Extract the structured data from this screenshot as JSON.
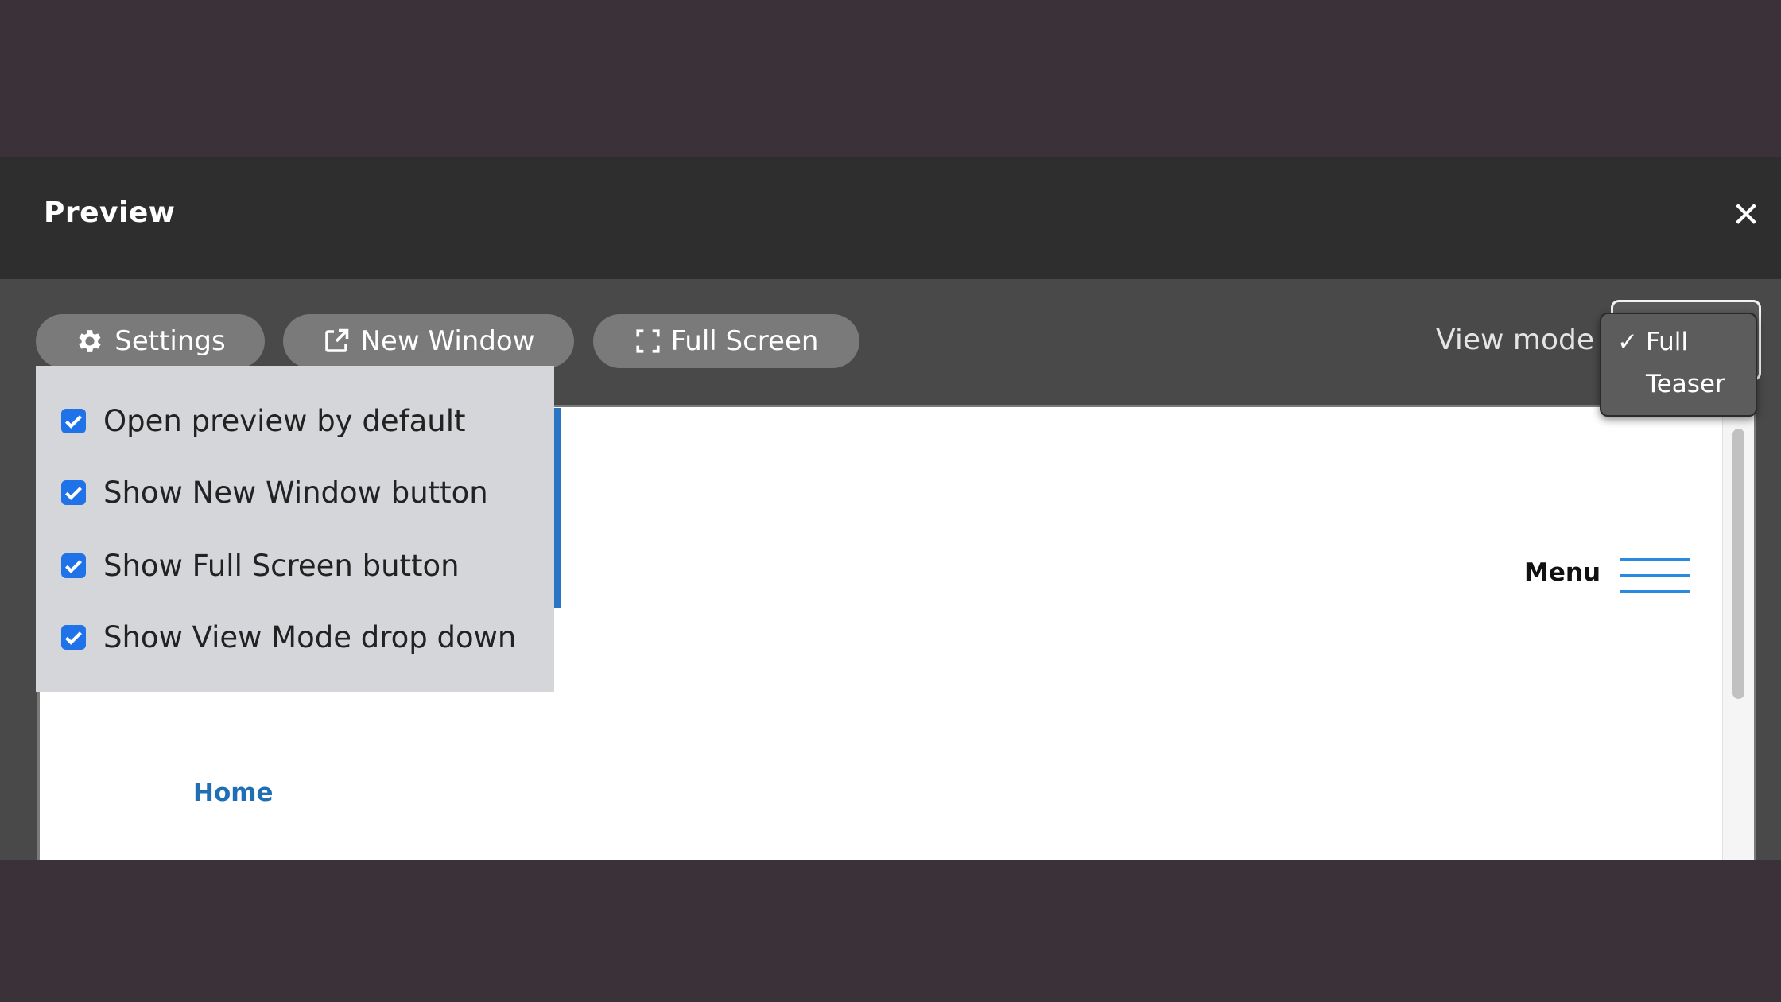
{
  "dialog": {
    "title": "Preview",
    "close_glyph": "✕"
  },
  "toolbar": {
    "settings_label": "Settings",
    "new_window_label": "New Window",
    "full_screen_label": "Full Screen"
  },
  "view_mode": {
    "label": "View mode",
    "options": [
      {
        "label": "Full",
        "selected": true,
        "check": "✓"
      },
      {
        "label": "Teaser",
        "selected": false,
        "check": ""
      }
    ]
  },
  "settings_menu": {
    "items": [
      {
        "label": "Open preview by default",
        "checked": true
      },
      {
        "label": "Show New Window button",
        "checked": true
      },
      {
        "label": "Show Full Screen button",
        "checked": true
      },
      {
        "label": "Show View Mode drop down",
        "checked": true
      }
    ]
  },
  "preview": {
    "menu_label": "Menu",
    "home_link": "Home"
  },
  "colors": {
    "accent": "#2a74c4",
    "checkbox": "#1f72e8",
    "link": "#1f6fb5",
    "hamburger": "#2a8adf"
  },
  "icons": {
    "settings": "gear-icon",
    "new_window": "external-link-icon",
    "full_screen": "expand-icon",
    "close": "close-icon",
    "menu": "hamburger-icon"
  }
}
